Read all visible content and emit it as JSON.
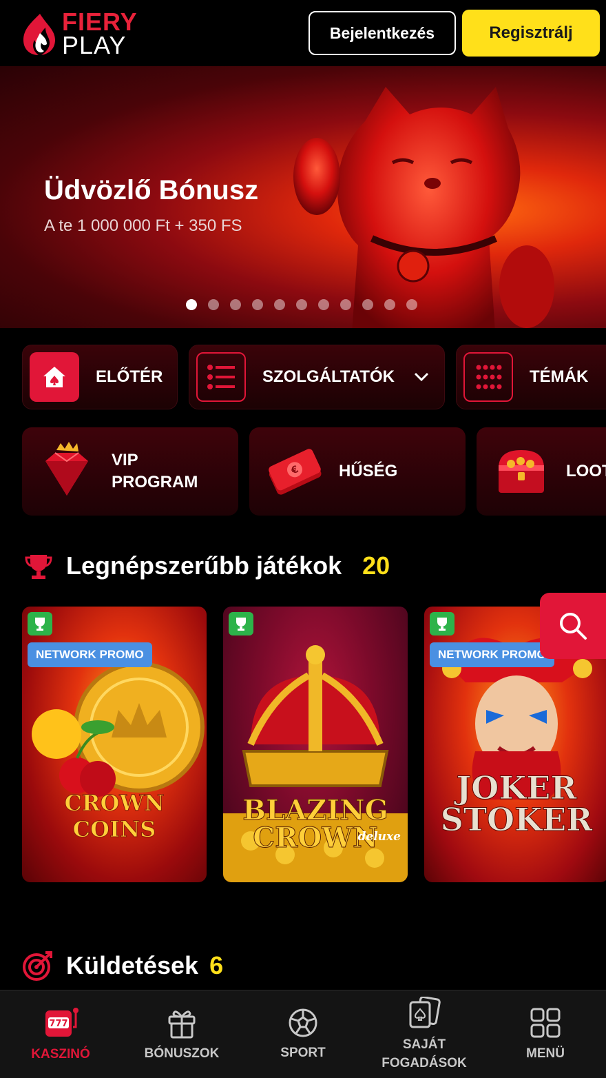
{
  "header": {
    "logo_line1": "FIERY",
    "logo_line2": "PLAY",
    "login_label": "Bejelentkezés",
    "register_label": "Regisztrálj"
  },
  "banner": {
    "title": "Üdvözlő Bónusz",
    "subtitle": "A te 1 000 000 Ft + 350 FS",
    "slides_total": 11,
    "active_slide": 1
  },
  "nav_chips": [
    {
      "label": "ELŐTÉR",
      "icon": "home-spade-icon"
    },
    {
      "label": "SZOLGÁLTATÓK",
      "icon": "list-icon"
    },
    {
      "label": "TÉMÁK",
      "icon": "grid-dots-icon"
    }
  ],
  "promos": [
    {
      "label_1": "VIP",
      "label_2": "PROGRAM",
      "icon": "diamond-crown-icon"
    },
    {
      "label_1": "HŰSÉG",
      "icon": "cash-icon"
    },
    {
      "label_1": "LOOT",
      "icon": "treasure-chest-icon"
    }
  ],
  "popular": {
    "title": "Legnépszerűbb játékok",
    "count": "20"
  },
  "games": [
    {
      "title_1": "CROWN COINS",
      "badge": "NETWORK PROMO"
    },
    {
      "title_1": "BLAZING",
      "title_2": "CROWN",
      "title_3": "deluxe"
    },
    {
      "title_1": "JOKER",
      "title_2": "STOKER",
      "badge": "NETWORK PROMO"
    }
  ],
  "missions": {
    "title": "Küldetések",
    "count": "6"
  },
  "bottom_nav": [
    {
      "label": "KASZINÓ",
      "icon": "slot-machine-icon",
      "active": true
    },
    {
      "label": "BÓNUSZOK",
      "icon": "gift-icon"
    },
    {
      "label": "SPORT",
      "icon": "soccer-ball-icon"
    },
    {
      "label_1": "SAJÁT",
      "label_2": "FOGADÁSOK",
      "icon": "cards-icon"
    },
    {
      "label": "MENÜ",
      "icon": "menu-grid-icon"
    }
  ],
  "colors": {
    "brand_red": "#e11638",
    "accent_yellow": "#ffe01a",
    "promo_blue": "#4a90e2",
    "badge_green": "#2db34a"
  }
}
